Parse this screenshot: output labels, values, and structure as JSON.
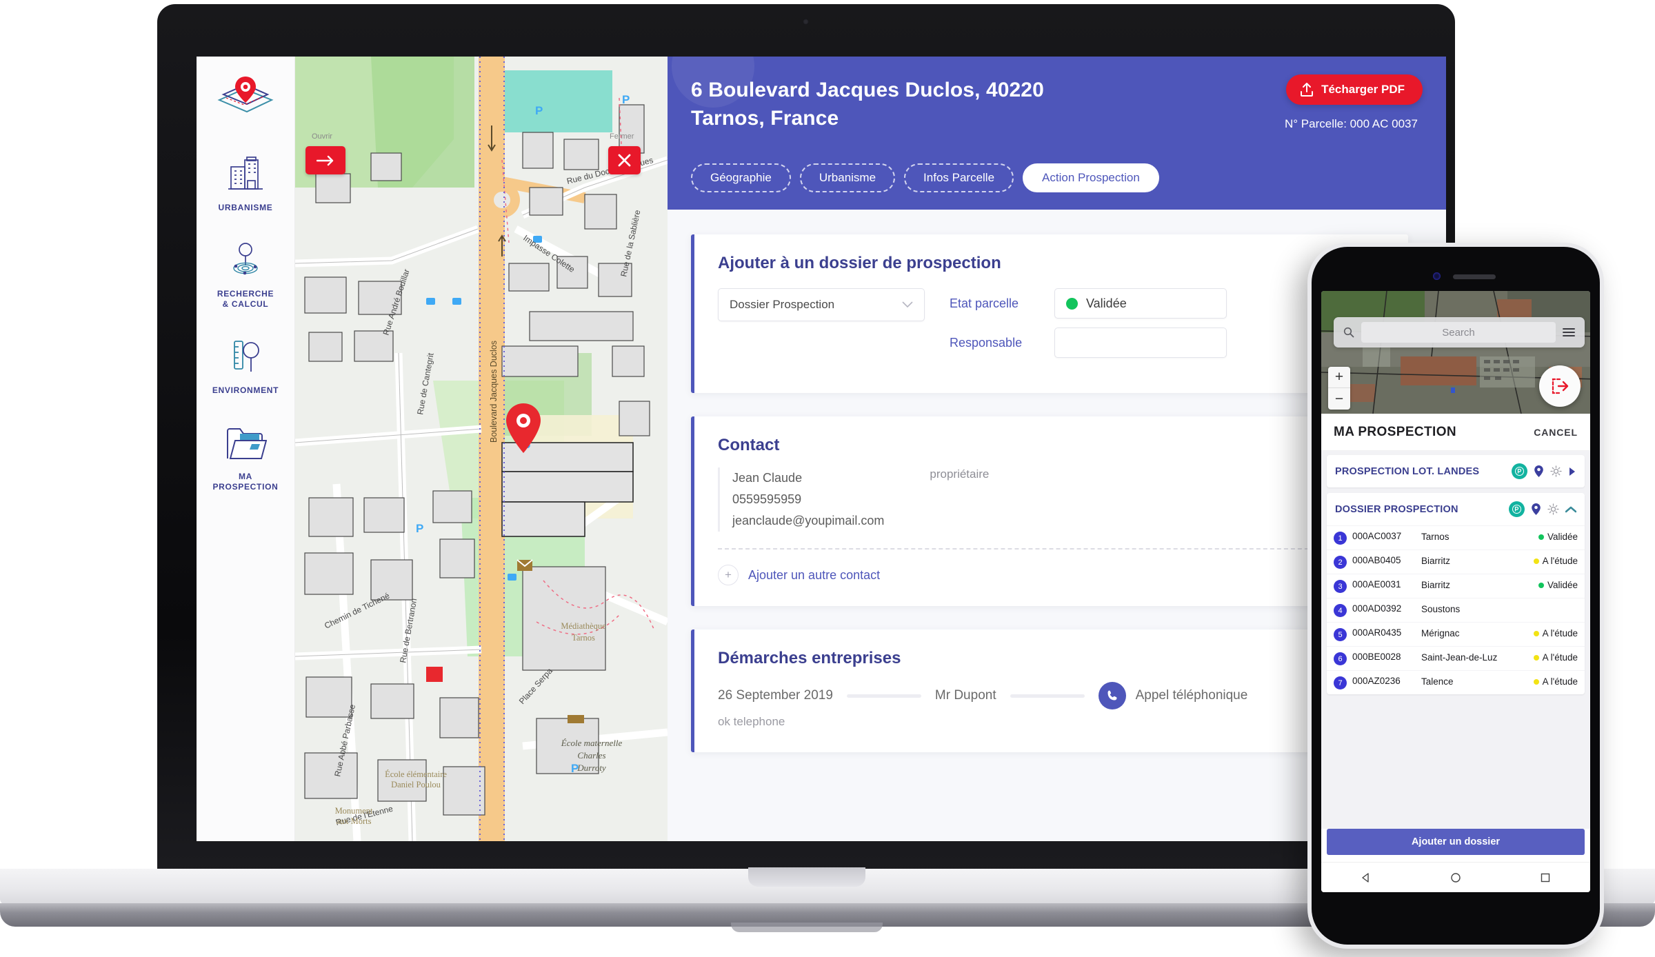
{
  "sidebar": {
    "items": [
      {
        "label": "",
        "icon": "map-pin-layers-logo"
      },
      {
        "label": "URBANISME",
        "icon": "buildings-icon"
      },
      {
        "label": "RECHERCHE\n& CALCUL",
        "line1": "RECHERCHE",
        "line2": "& CALCUL",
        "icon": "search-radar-icon"
      },
      {
        "label": "ENVIRONMENT",
        "icon": "ruler-magnifier-icon"
      },
      {
        "label": "MA\nPROSPECTION",
        "line1": "MA",
        "line2": "PROSPECTION",
        "icon": "folder-icon"
      }
    ]
  },
  "map": {
    "open_tooltip": "Ouvrir",
    "close_tooltip": "Fermer",
    "open_button_icon": "arrow-right-icon",
    "close_button_icon": "close-x-icon",
    "street_labels": [
      "Boulevard Jacques Duclos",
      "Rue du Docteur Nogues",
      "Impasse Colette",
      "Rue de la Sablière",
      "Rue André Bouillar",
      "Rue de Bertranon",
      "Chemin de Tichené",
      "Place Serpa",
      "Rue de Cantegrit",
      "Rue Abbé Parbasse",
      "Rue de l'Etenne"
    ],
    "poi_labels": [
      "École maternelle Charles Durroty",
      "Médiathèque Tarnos",
      "Monument aux Morts",
      "École élémentaire Daniel Poulou / Paul Langevin"
    ],
    "marker_icon": "red-map-pin"
  },
  "header": {
    "title": "6 Boulevard Jacques Duclos, 40220 Tarnos, France",
    "pdf_button": "Técharger PDF",
    "pdf_icon": "upload-icon",
    "parcelle_label": "N° Parcelle: 000 AC 0037",
    "accent": "#4e56ba",
    "red": "#e8182a",
    "tabs": [
      {
        "label": "Géographie",
        "active": false
      },
      {
        "label": "Urbanisme",
        "active": false
      },
      {
        "label": "Infos Parcelle",
        "active": false
      },
      {
        "label": "Action Prospection",
        "active": true
      }
    ]
  },
  "prospection": {
    "title": "Ajouter à un dossier de prospection",
    "select_value": "Dossier Prospection",
    "select_icon": "chevron-down-icon",
    "etat_label": "Etat parcelle",
    "etat_value": "Validée",
    "etat_color": "#12c45c",
    "responsable_label": "Responsable",
    "responsable_value": ""
  },
  "contact": {
    "title": "Contact",
    "name": "Jean Claude",
    "phone": "0559595959",
    "email": "jeanclaude@youpimail.com",
    "role": "propriétaire",
    "add_label": "Ajouter un autre contact",
    "add_icon": "plus-icon"
  },
  "demarches": {
    "title": "Démarches entreprises",
    "date": "26 September 2019",
    "person": "Mr Dupont",
    "type": "Appel téléphonique",
    "type_icon": "phone-icon",
    "note": "ok telephone"
  },
  "phone": {
    "search_placeholder": "Search",
    "search_icon": "search-icon",
    "menu_icon": "hamburger-icon",
    "zoom_in": "+",
    "zoom_out": "−",
    "fab_icon": "export-icon",
    "title": "MA PROSPECTION",
    "cancel": "CANCEL",
    "folders": [
      {
        "name": "PROSPECTION LOT. LANDES",
        "icons": [
          "p-badge-icon",
          "map-pin-icon",
          "gear-icon",
          "chevron-right-icon"
        ],
        "expanded": false,
        "rows": []
      },
      {
        "name": "DOSSIER PROSPECTION",
        "icons": [
          "p-badge-icon",
          "map-pin-icon",
          "gear-icon",
          "chevron-up-icon"
        ],
        "expanded": true,
        "rows": [
          {
            "n": "1",
            "ref": "000AC0037",
            "city": "Tarnos",
            "status": "Validée",
            "color": "#12c45c"
          },
          {
            "n": "2",
            "ref": "000AB0405",
            "city": "Biarritz",
            "status": "A l'étude",
            "color": "#f2e314"
          },
          {
            "n": "3",
            "ref": "000AE0031",
            "city": "Biarritz",
            "status": "Validée",
            "color": "#12c45c"
          },
          {
            "n": "4",
            "ref": "000AD0392",
            "city": "Soustons",
            "status": "",
            "color": ""
          },
          {
            "n": "5",
            "ref": "000AR0435",
            "city": "Mérignac",
            "status": "A l'étude",
            "color": "#f2e314"
          },
          {
            "n": "6",
            "ref": "000BE0028",
            "city": "Saint-Jean-de-Luz",
            "status": "A l'étude",
            "color": "#f2e314"
          },
          {
            "n": "7",
            "ref": "000AZ0236",
            "city": "Talence",
            "status": "A l'étude",
            "color": "#f2e314"
          }
        ]
      }
    ],
    "cta": "Ajouter un dossier",
    "nav": [
      "back-triangle-icon",
      "home-circle-icon",
      "recents-square-icon"
    ]
  }
}
